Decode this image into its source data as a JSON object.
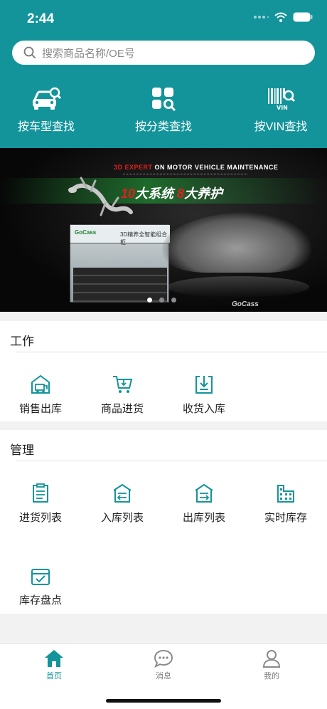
{
  "status_bar": {
    "time": "2:44"
  },
  "search": {
    "placeholder": "搜索商品名称/OE号"
  },
  "quick_actions": [
    {
      "label": "按车型查找",
      "icon": "car-search-icon"
    },
    {
      "label": "按分类查找",
      "icon": "category-icon"
    },
    {
      "label": "按VIN查找",
      "icon": "vin-barcode-icon"
    }
  ],
  "banner": {
    "headline_red": "3D EXPERT",
    "headline_rest": " ON MOTOR VEHICLE MAINTENANCE",
    "slogan_num1": "10",
    "slogan_text1": "大系统  ",
    "slogan_num2": "8",
    "slogan_text2": "大养护",
    "cabinet_brand": "GoCass",
    "cabinet_label": "3D精养全智能组合柜",
    "logo": "GoCass",
    "active_slide": 1,
    "slide_count": 3
  },
  "work": {
    "title": "工作",
    "items": [
      {
        "label": "销售出库",
        "icon": "sales-outbound-icon"
      },
      {
        "label": "商品进货",
        "icon": "purchase-cart-icon"
      },
      {
        "label": "收货入库",
        "icon": "receive-download-icon"
      }
    ]
  },
  "manage": {
    "title": "管理",
    "items": [
      {
        "label": "进货列表",
        "icon": "purchase-list-icon"
      },
      {
        "label": "入库列表",
        "icon": "inbound-list-icon"
      },
      {
        "label": "出库列表",
        "icon": "outbound-list-icon"
      },
      {
        "label": "实时库存",
        "icon": "realtime-stock-icon"
      },
      {
        "label": "库存盘点",
        "icon": "stock-check-icon"
      }
    ]
  },
  "tabbar": {
    "items": [
      {
        "label": "首页",
        "icon": "home-icon",
        "active": true
      },
      {
        "label": "消息",
        "icon": "message-icon",
        "active": false
      },
      {
        "label": "我的",
        "icon": "profile-icon",
        "active": false
      }
    ]
  },
  "colors": {
    "primary": "#13949b",
    "background": "#f2f2f2",
    "text": "#222222"
  }
}
